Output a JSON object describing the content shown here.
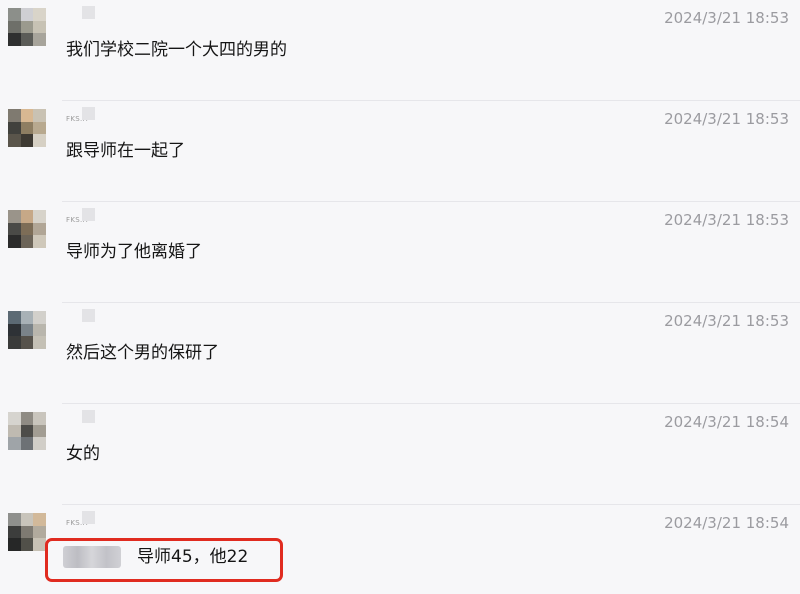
{
  "messages": [
    {
      "time": "2024/3/21 18:53",
      "text": "我们学校二院一个大四的男的",
      "name_fragment": "",
      "avatar_icon": "pixelated-avatar-icon"
    },
    {
      "time": "2024/3/21 18:53",
      "text": "跟导师在一起了",
      "name_fragment": "FKS.H",
      "avatar_icon": "pixelated-avatar-icon"
    },
    {
      "time": "2024/3/21 18:53",
      "text": "导师为了他离婚了",
      "name_fragment": "FKS.H",
      "avatar_icon": "pixelated-avatar-icon"
    },
    {
      "time": "2024/3/21 18:53",
      "text": "然后这个男的保研了",
      "name_fragment": "",
      "avatar_icon": "pixelated-avatar-icon"
    },
    {
      "time": "2024/3/21 18:54",
      "text": "女的",
      "name_fragment": "",
      "avatar_icon": "pixelated-avatar-icon"
    },
    {
      "time": "2024/3/21 18:54",
      "text": "导师45，他22",
      "name_fragment": "FKS.H",
      "avatar_icon": "pixelated-avatar-icon"
    }
  ],
  "colors": {
    "background": "#f7f7f9",
    "timestamp": "#9b9ba0",
    "highlight_border": "#e02b20",
    "divider": "#e6e6ea"
  }
}
